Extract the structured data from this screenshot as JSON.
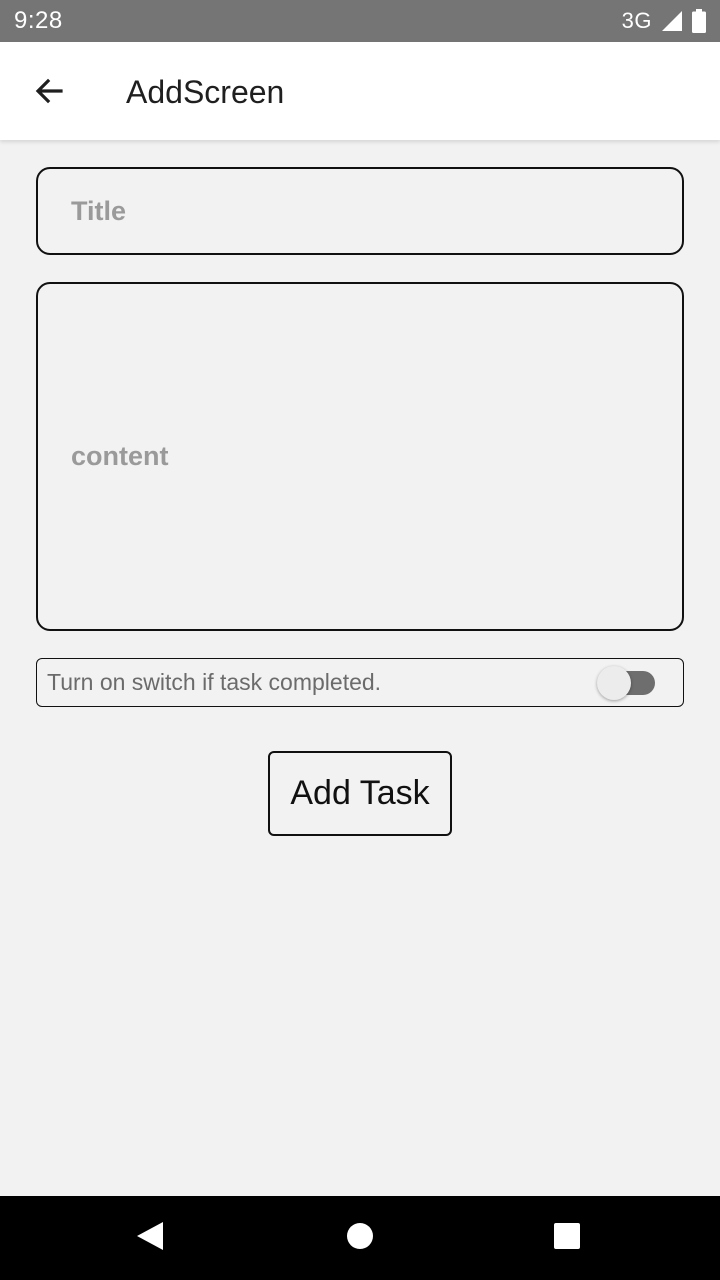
{
  "status_bar": {
    "time": "9:28",
    "network": "3G",
    "icons": [
      "signal-icon",
      "battery-icon"
    ]
  },
  "app_bar": {
    "title": "AddScreen",
    "back_icon": "arrow-back-icon"
  },
  "form": {
    "title_field": {
      "value": "",
      "placeholder": "Title"
    },
    "content_field": {
      "value": "",
      "placeholder": "content"
    },
    "completed_switch": {
      "label": "Turn on switch if task completed.",
      "checked": false
    },
    "add_button_label": "Add Task"
  },
  "nav_bar": {
    "icons": [
      "back-triangle-icon",
      "home-circle-icon",
      "recents-square-icon"
    ]
  },
  "colors": {
    "status_bar": "#757575",
    "app_bar": "#ffffff",
    "background": "#f2f2f2",
    "border": "#111111",
    "placeholder": "#9a9a9a",
    "nav_bar": "#000000"
  }
}
